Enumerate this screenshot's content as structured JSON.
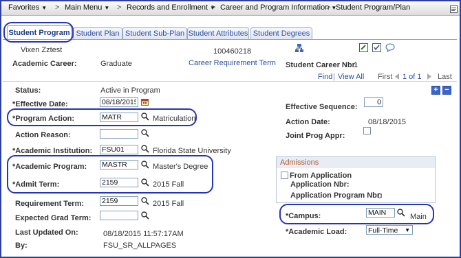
{
  "nav": {
    "favorites": "Favorites",
    "main_menu": "Main Menu",
    "sep": ">",
    "records": "Records and Enrollment",
    "career": "Career and Program Information",
    "current": "Student Program/Plan"
  },
  "tabs": [
    {
      "label": "Student Program",
      "active": true
    },
    {
      "label": "Student Plan",
      "active": false
    },
    {
      "label": "Student Sub-Plan",
      "active": false
    },
    {
      "label": "Student Attributes",
      "active": false
    },
    {
      "label": "Student Degrees",
      "active": false
    }
  ],
  "header": {
    "student_name": "Vixen Zztest",
    "student_id": "100460218",
    "academic_career_label": "Academic Career:",
    "academic_career_value": "Graduate",
    "career_requirement_term_link": "Career Requirement Term",
    "student_career_nbr_label": "Student Career Nbr:",
    "student_career_nbr_value": "1"
  },
  "nav_row": {
    "find": "Find",
    "view_all": "View All",
    "first": "First",
    "count": "1 of 1",
    "last": "Last",
    "sep": "|"
  },
  "form": {
    "status_label": "Status:",
    "status_value": "Active in Program",
    "effective_date_label": "*Effective Date:",
    "effective_date_value": "08/18/2015",
    "effective_sequence_label": "Effective Sequence:",
    "effective_sequence_value": "0",
    "program_action_label": "*Program Action:",
    "program_action_value": "MATR",
    "program_action_desc": "Matriculation",
    "action_date_label": "Action Date:",
    "action_date_value": "08/18/2015",
    "action_reason_label": "Action Reason:",
    "action_reason_value": "",
    "joint_prog_label": "Joint Prog Appr:",
    "academic_institution_label": "*Academic Institution:",
    "academic_institution_value": "FSU01",
    "academic_institution_desc": "Florida State University",
    "academic_program_label": "*Academic Program:",
    "academic_program_value": "MASTR",
    "academic_program_desc": "Master's Degree",
    "admit_term_label": "*Admit Term:",
    "admit_term_value": "2159",
    "admit_term_desc": "2015 Fall",
    "requirement_term_label": "Requirement Term:",
    "requirement_term_value": "2159",
    "requirement_term_desc": "2015 Fall",
    "expected_grad_label": "Expected Grad Term:",
    "expected_grad_value": "",
    "last_updated_label": "Last Updated On:",
    "last_updated_value": "08/18/2015 11:57:17AM",
    "by_label": "By:",
    "by_value": "FSU_SR_ALLPAGES",
    "campus_label": "*Campus:",
    "campus_value": "MAIN",
    "campus_desc": "Main",
    "academic_load_label": "*Academic Load:",
    "academic_load_value": "Full-Time"
  },
  "admissions": {
    "title": "Admissions",
    "from_application": "From Application",
    "application_nbr_label": "Application Nbr:",
    "application_program_nbr_label": "Application Program Nbr:",
    "application_program_nbr_value": "0"
  },
  "colors": {
    "highlight": "#2533b8",
    "link": "#2b4f9e",
    "admissions_title": "#b0592a"
  }
}
